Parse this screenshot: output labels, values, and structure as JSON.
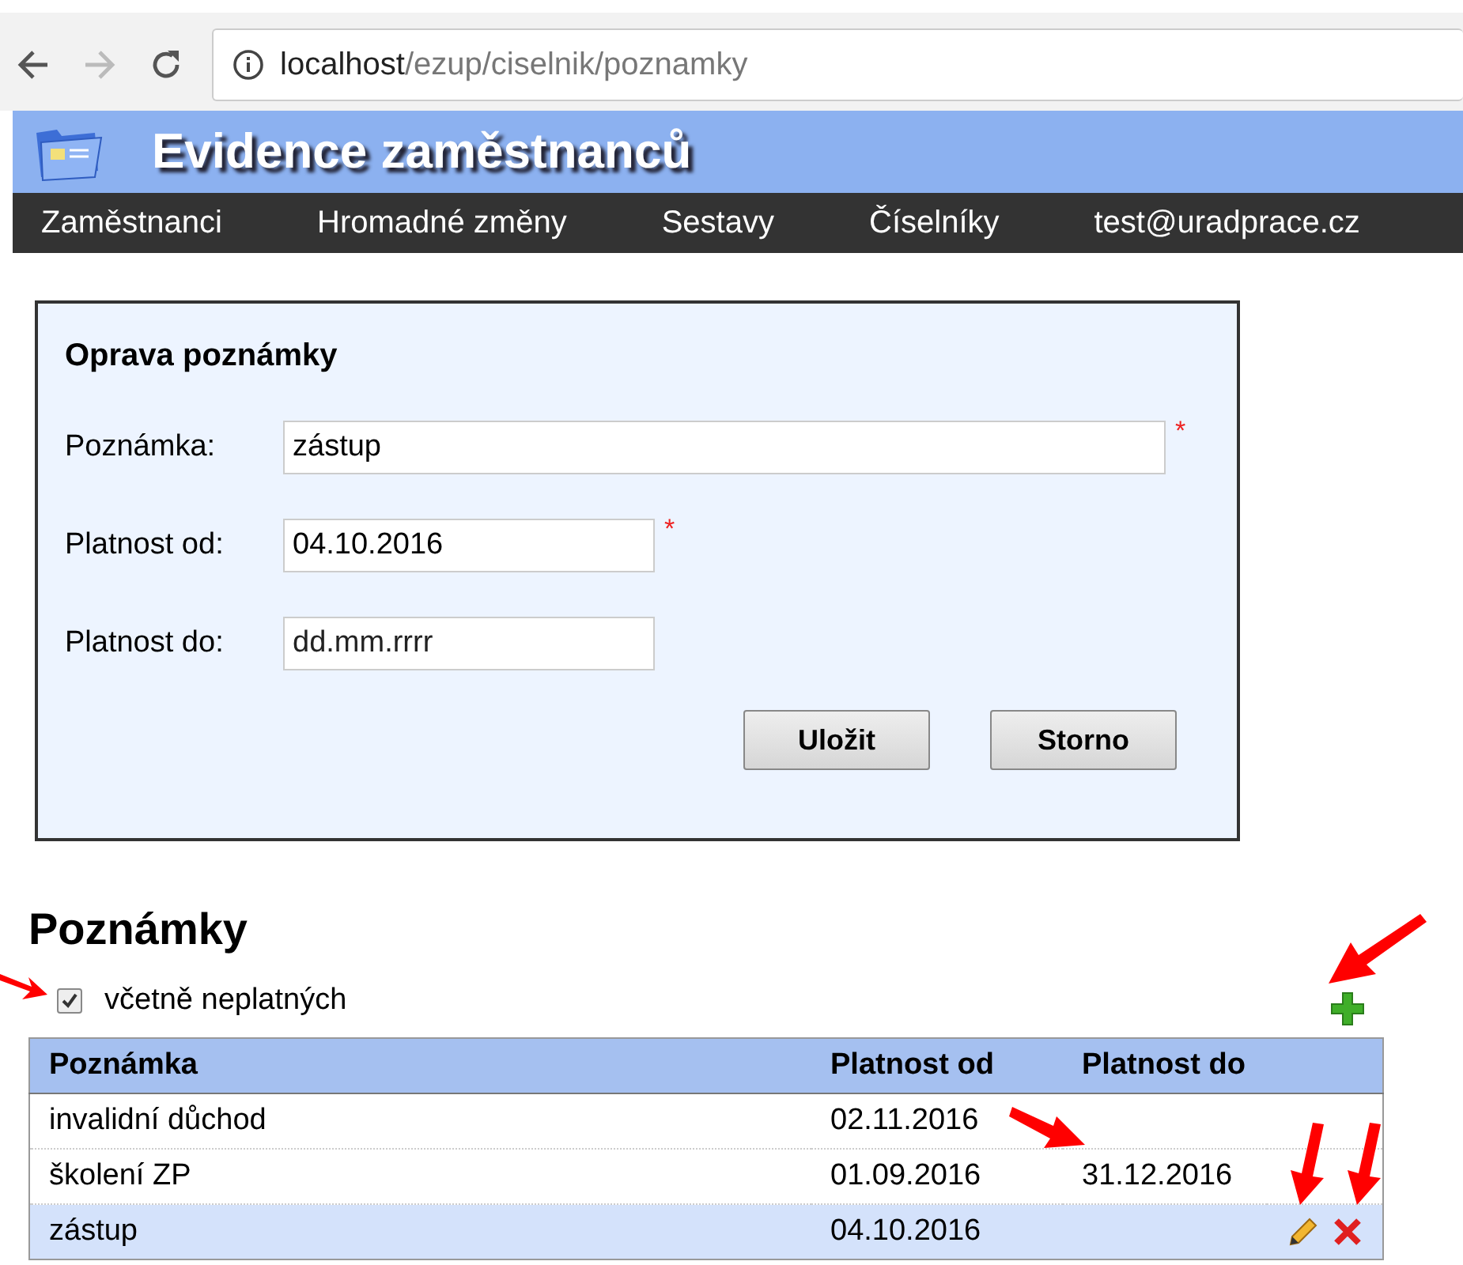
{
  "browser": {
    "url_host": "localhost",
    "url_path": "/ezup/ciselnik/poznamky"
  },
  "app": {
    "title": "Evidence zaměstnanců"
  },
  "nav": [
    {
      "label": "Zaměstnanci"
    },
    {
      "label": "Hromadné změny"
    },
    {
      "label": "Sestavy"
    },
    {
      "label": "Číselníky"
    },
    {
      "label": "test@uradprace.cz"
    }
  ],
  "form": {
    "title": "Oprava poznámky",
    "fields": [
      {
        "label": "Poznámka:",
        "kind": "text",
        "value": "zástup",
        "required_mark": "*"
      },
      {
        "label": "Platnost od:",
        "kind": "date",
        "value": "04.10.2016",
        "required_mark": "*"
      },
      {
        "label": "Platnost do:",
        "kind": "date",
        "placeholder": "dd.mm.rrrr"
      }
    ],
    "buttons": [
      "Uložit",
      "Storno"
    ]
  },
  "list": {
    "title": "Poznámky",
    "include_invalid": {
      "label": "včetně neplatných",
      "checked": true
    },
    "columns": [
      "Poznámka",
      "Platnost od",
      "Platnost do"
    ],
    "rows": [
      {
        "cells": [
          "invalidní důchod",
          "02.11.2016",
          ""
        ],
        "selected": false
      },
      {
        "cells": [
          "školení ZP",
          "01.09.2016",
          "31.12.2016"
        ],
        "selected": false
      },
      {
        "cells": [
          "zástup",
          "04.10.2016",
          ""
        ],
        "selected": true
      }
    ]
  }
}
